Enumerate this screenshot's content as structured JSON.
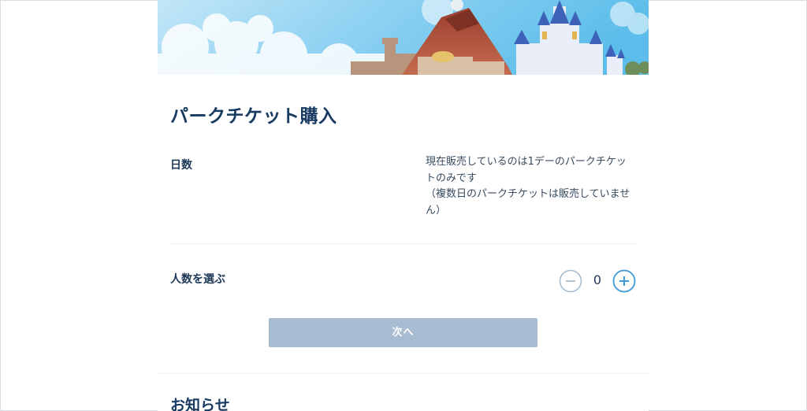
{
  "hero": {
    "image": "tokyo-disney-resort-banner",
    "colors": {
      "sky": "#7fcdf0",
      "volcano": "#b4553f",
      "castle": "#dfe7f5"
    }
  },
  "purchase": {
    "title": "パークチケット購入",
    "days": {
      "label": "日数",
      "note_lines": [
        "現在販売しているのは1デーのパークチケッ",
        "トのみです",
        "（複数日のパークチケットは販売していませ",
        "ん）"
      ]
    },
    "people": {
      "label": "人数を選ぶ",
      "count": "0",
      "minus_icon": "minus-circle-icon",
      "plus_icon": "plus-circle-icon"
    },
    "next_button": "次へ"
  },
  "news": {
    "title": "お知らせ"
  },
  "colors": {
    "accent": "#3a9ad9",
    "button_disabled": "#a7bcd0",
    "heading": "#173a61"
  }
}
